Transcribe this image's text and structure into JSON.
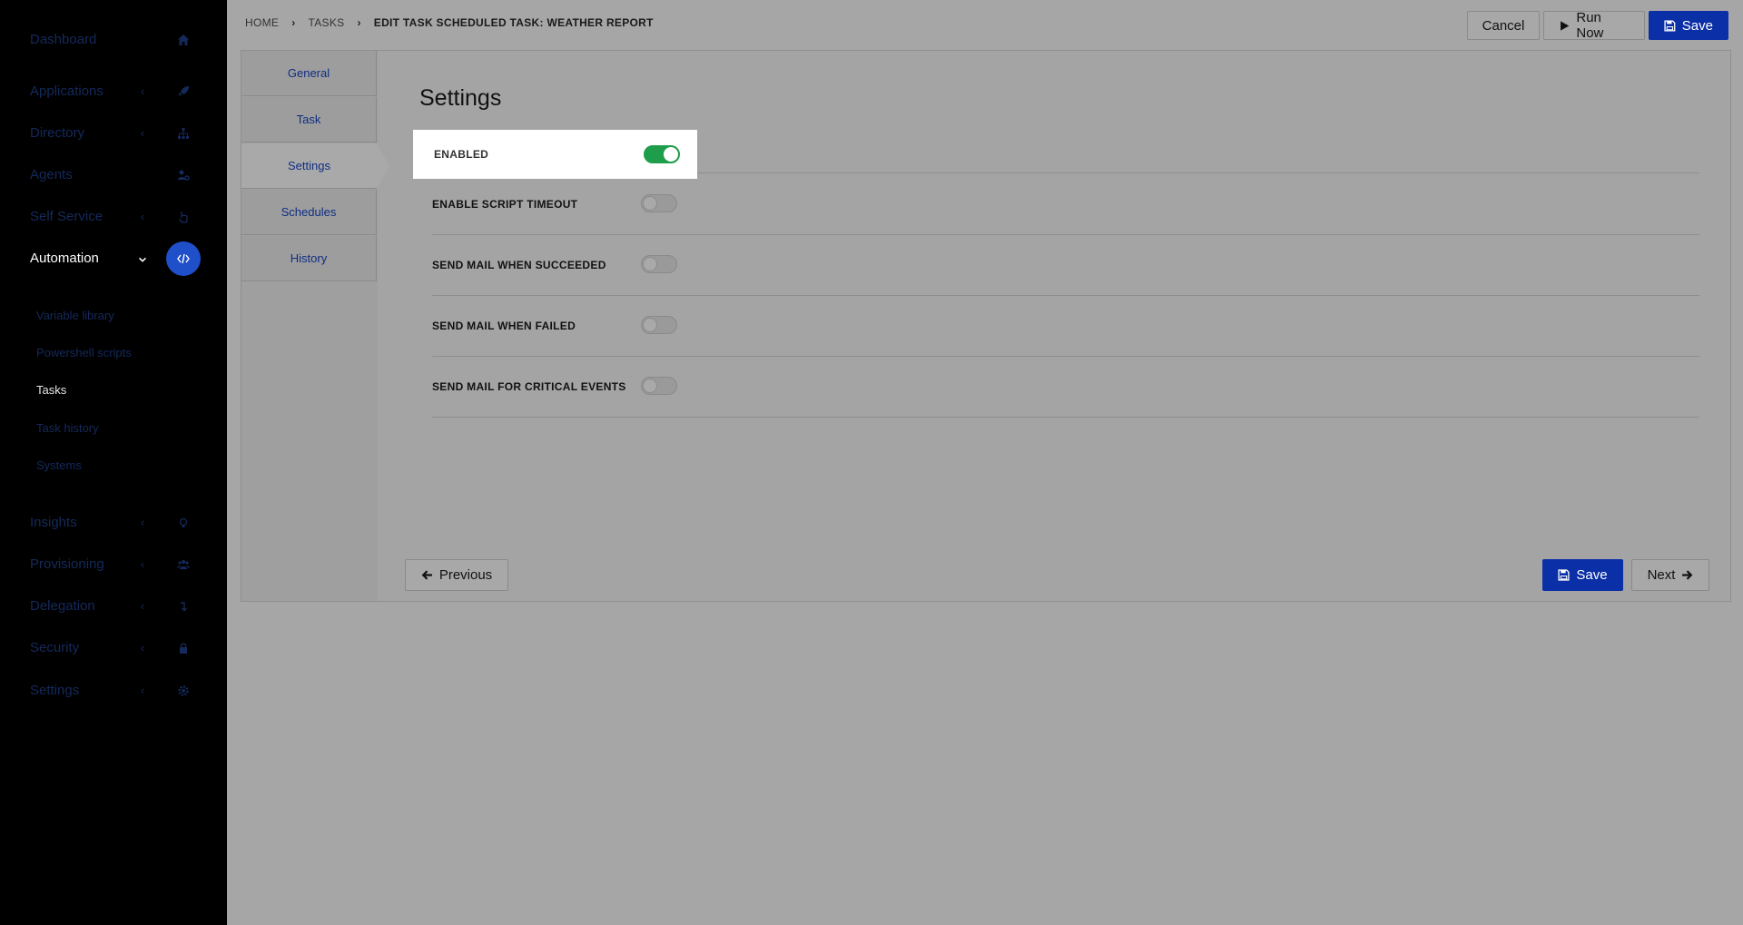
{
  "sidebar": {
    "items": [
      {
        "label": "Dashboard",
        "icon": "home-icon",
        "chevron": false
      },
      {
        "label": "Applications",
        "icon": "rocket-icon",
        "chevron": true
      },
      {
        "label": "Directory",
        "icon": "sitemap-icon",
        "chevron": true
      },
      {
        "label": "Agents",
        "icon": "users-cog-icon",
        "chevron": false
      },
      {
        "label": "Self Service",
        "icon": "hand-pointer-icon",
        "chevron": true
      },
      {
        "label": "Automation",
        "icon": "code-icon",
        "chevron": true,
        "active": true
      },
      {
        "label": "Insights",
        "icon": "lightbulb-icon",
        "chevron": true
      },
      {
        "label": "Provisioning",
        "icon": "users-icon",
        "chevron": true
      },
      {
        "label": "Delegation",
        "icon": "level-down-icon",
        "chevron": true
      },
      {
        "label": "Security",
        "icon": "lock-icon",
        "chevron": true
      },
      {
        "label": "Settings",
        "icon": "gear-icon",
        "chevron": true
      }
    ],
    "automation_subitems": [
      "Variable library",
      "Powershell scripts",
      "Tasks",
      "Task history",
      "Systems"
    ],
    "active_subitem": "Tasks"
  },
  "breadcrumb": {
    "home": "HOME",
    "tasks": "TASKS",
    "current": "EDIT TASK SCHEDULED TASK: WEATHER REPORT"
  },
  "top_actions": {
    "cancel": "Cancel",
    "run_now": "Run Now",
    "save": "Save"
  },
  "tabs": [
    "General",
    "Task",
    "Settings",
    "Schedules",
    "History"
  ],
  "active_tab": "Settings",
  "section_title": "Settings",
  "settings": [
    {
      "label": "ENABLED",
      "on": true
    },
    {
      "label": "ENABLE SCRIPT TIMEOUT",
      "on": false
    },
    {
      "label": "SEND MAIL WHEN SUCCEEDED",
      "on": false
    },
    {
      "label": "SEND MAIL WHEN FAILED",
      "on": false
    },
    {
      "label": "SEND MAIL FOR CRITICAL EVENTS",
      "on": false
    }
  ],
  "bottom_actions": {
    "previous": "Previous",
    "save": "Save",
    "next": "Next"
  },
  "colors": {
    "primary": "#0a2fa6",
    "toggle_on": "#1e9e4a",
    "sidebar_bg": "#000000",
    "nav_active_icon": "#1f4fc9"
  }
}
